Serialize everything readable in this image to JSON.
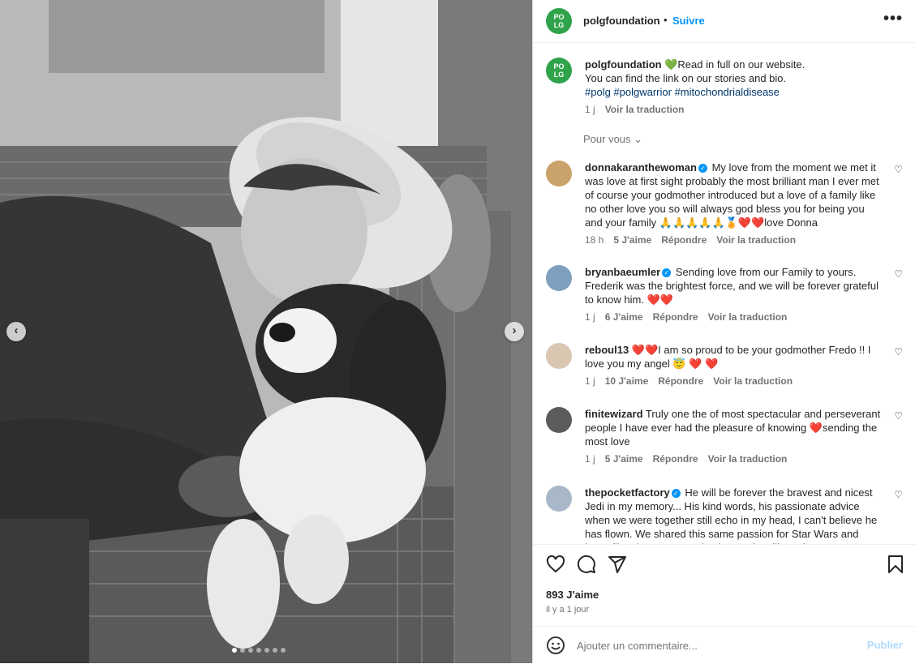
{
  "header": {
    "username": "polgfoundation",
    "separator": "•",
    "follow_label": "Suivre",
    "more_label": "•••"
  },
  "logo": {
    "text_top": "PO",
    "text_bottom": "LG",
    "color": "#2fa34a"
  },
  "caption": {
    "username": "polgfoundation",
    "text_line1": "💚Read in full on our website.",
    "text_line2": "You can find the link on our stories and bio.",
    "hashtags": "#polg #polgwarrior #mitochondrialdisease",
    "time": "1 j",
    "translate": "Voir la traduction"
  },
  "pour_vous": "Pour vous ⌄",
  "comments": [
    {
      "username": "donnakaranthewoman",
      "verified": "✓",
      "text": "My love from the moment we met it was love at first sight probably the most brilliant man I ever met of course your godmother introduced but a love of a family like no other love you so will always god bless you for being you and your family 🙏🙏🙏🙏🙏🏅❤️❤️love Donna",
      "time": "18 h",
      "likes": "5 J'aime",
      "reply": "Répondre",
      "translate": "Voir la traduction"
    },
    {
      "username": "bryanbaeumler",
      "verified": "✓",
      "text": "Sending love from our Family to yours. Frederik was the brightest force, and we will be forever grateful to know him. ❤️❤️",
      "time": "1 j",
      "likes": "6 J'aime",
      "reply": "Répondre",
      "translate": "Voir la traduction"
    },
    {
      "username": "reboul13",
      "verified": "",
      "text": "❤️❤️I am so proud to be your godmother Fredo !! I love you my angel 😇 ❤️ ❤️",
      "time": "1 j",
      "likes": "10 J'aime",
      "reply": "Répondre",
      "translate": "Voir la traduction"
    },
    {
      "username": "finitewizard",
      "verified": "",
      "text": "Truly one the of most spectacular and perseverant people I have ever had the pleasure of knowing ❤️sending the most love",
      "time": "1 j",
      "likes": "5 J'aime",
      "reply": "Répondre",
      "translate": "Voir la traduction"
    },
    {
      "username": "thepocketfactory",
      "verified": "✓",
      "text": "He will be forever the bravest and nicest Jedi in my memory... His kind words, his passionate advice when we were together still echo in my head, I can't believe he has flown. We shared this same passion for Star Wars and butterflies, he was so enthusiast and smiling, always ! Un",
      "time": "",
      "likes": "",
      "reply": "",
      "translate": ""
    }
  ],
  "likes_count": "893 J'aime",
  "post_time": "il y a 1 jour",
  "add_comment": {
    "placeholder": "Ajouter un commentaire...",
    "publish_label": "Publier"
  },
  "carousel": {
    "slide_count": 7,
    "active_index": 0
  },
  "icons": {
    "like": "heart-icon",
    "comment": "comment-icon",
    "share": "share-icon",
    "save": "bookmark-icon",
    "emoji": "emoji-icon",
    "prev": "chevron-left-icon",
    "next": "chevron-right-icon"
  },
  "colors": {
    "link_blue": "#0095f6",
    "hashtag": "#00376b",
    "muted": "#737373",
    "heart_red": "#ed4956"
  }
}
